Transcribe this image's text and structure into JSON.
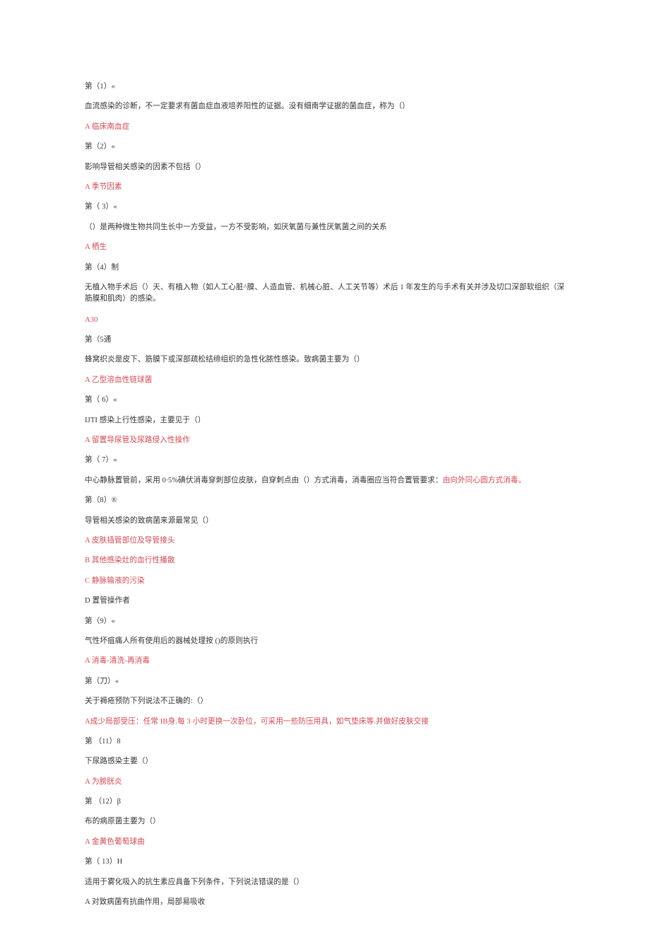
{
  "items": [
    {
      "header": "第（1）«",
      "body": "血流感染的诊断，不一定要求有菌血症血液培养阳性的证据。没有细南学证据的菌血症，称为（）",
      "answer": "A 临床南血症"
    },
    {
      "header": "第（2）«",
      "body": "影响导管相关感染的因素不包括（）",
      "answer": "A 季节因素"
    },
    {
      "header": "第（ 3）«",
      "body": "（）是两种微生物共同生长中一方受益，一方不受影响，如厌氧菌与兼性厌氧菌之间的关系",
      "answer": "A 栖生"
    },
    {
      "header": "第（4）制",
      "body": "无植入物手术后（）天、有植入物（如人工心脏^膜、人造血管、机械心脏、人工关节等）术后 1 年发生的与手术有关并涉及切口深部软组织（深筋膜和肌肉）的感染。",
      "answer": "A30"
    },
    {
      "header": "第（5通",
      "body": "蜂窝织炎是皮下、筋膜下或深部疏松结缔组织的急性化脓性感染。致病菌主要为（）",
      "answer": "A 乙型溶血性链球菌"
    },
    {
      "header": "第（ 6）«",
      "body": "IJTI 感染上行性感染，主要见于（）",
      "answer": "A 留置导尿管及尿路侵入性操作"
    }
  ],
  "item7": {
    "header": "第（ 7）«",
    "body_prefix": "中心静脉置管前，采用 0∙5%碘伏消毒穿刺部位皮肤，自穿刺点由（）方式消毒，消毒圈应当符合置管要求：",
    "answer_inline": "由向外同心圆方式消毒。"
  },
  "item8": {
    "header": "第（8）®",
    "body": "导管相关感染的致病菌来源最常见（）",
    "opts": [
      {
        "text": "A 皮肤插管部位及导管接头",
        "red": true
      },
      {
        "text": "B 其他感染灶的血行性播散",
        "red": true
      },
      {
        "text": "C 静脉输液的污染",
        "red": true
      },
      {
        "text": "D 置管操作者",
        "red": false
      }
    ]
  },
  "items2": [
    {
      "header": "第（9）«",
      "body": "气性坏疽痛人所有使用后的器械处理按 ()的原则执行",
      "answer": "A 消毒-清洗-再消毒"
    },
    {
      "header": "第（刀）«",
      "body": "关于褥疮预防下列说法不正确的:（）",
      "answer": "A成少局部受压：任常 IB身.每 3 小时更换一次卧位，可采用一些防压用具，如气垫床等.并做好皮肤交接"
    },
    {
      "header": "第 （11）8",
      "body": "下尿路感染主要（）",
      "answer": "A 为膀胱炎"
    },
    {
      "header": "第 （12）β",
      "body": "布的病原菌主要为（）",
      "answer": "A 金黄色葡萄球曲"
    }
  ],
  "item13": {
    "header": "第（ 13）H",
    "body": "适用于雾化吸入的抗生素应具备下列条件，下列说法错误的是（）",
    "opt": "A 对致病菌有抗曲作用，局部易吸收"
  }
}
